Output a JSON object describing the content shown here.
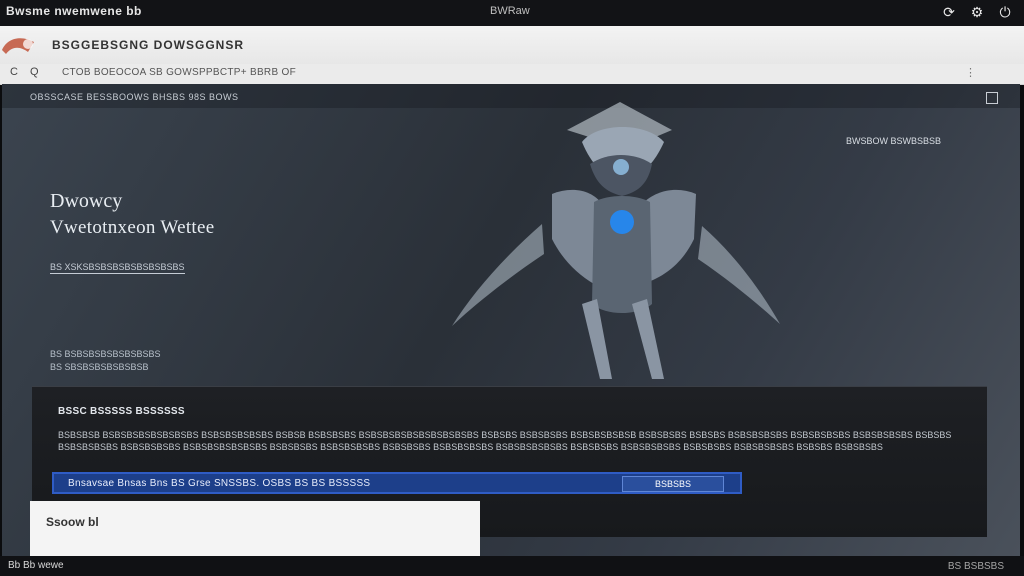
{
  "top_bar": {
    "left_text": "Bwsme nwemwene bb",
    "center_text": "BWRaw"
  },
  "title_bar": {
    "title": "BSGGEBSGNG DOWSGGNSR"
  },
  "address_bar": {
    "back": "C",
    "forward": "Q",
    "text": "CTOB BOEOCOA  SB GOWSPPBCTP+ BBRB OF"
  },
  "viewport": {
    "header": "OBSSCASE BESSBOOWS BHSBS 98S BOWS",
    "hero_title": "Dwowcy",
    "hero_subtitle": "Vwetotnxeon Wettee",
    "hero_underline": "BS XSKSBSBSBSBSBSBSBSBS",
    "side_note_1": "BS BSBSBSBSBSBSBSBS",
    "side_note_2": "BS SBSBSBSBSBSBSB",
    "right_note": "BWSBOW BSWBSBSB"
  },
  "panel": {
    "title": "BSSC BSSSSS BSSSSSS",
    "body": "BSBSBSB BSBSBSBSBSBSBSBS BSBSBSBSBSBS BSBSB BSBSBSBS BSBSBSBSBSBSBSBSBSBS BSBSBS BSBSBSBS BSBSBSBSBSB BSBSBSBS BSBSBS BSBSBSBSBS BSBSBSBSBS BSBSBSBSBS BSBSBS BSBSBSBSBS BSBSBSBSBS BSBSBSBSBSBSBS BSBSBSBS BSBSBSBSBS BSBSBSBS BSBSBSBSBS BSBSBSBSBSBS BSBSBSBS BSBSBSBSBS BSBSBSBS BSBSBSBSBS BSBSBS BSBSBSBS",
    "cta_text": "Bnsavsae Bnsas Bns BS Grse SNSSBS. OSBS BS BS BSSSSS",
    "cta_button": "BSBSBS"
  },
  "bottom_left": {
    "text": "Ssoow bl"
  },
  "status_bar": {
    "left": "Bb Bb wewe",
    "right": "BS BSBSBS"
  },
  "colors": {
    "cta": "#1d3f8a",
    "accent": "#2f5cc5",
    "viewport_bg": "#2a3038"
  },
  "icons": {
    "refresh": "refresh-icon",
    "settings": "gear-icon",
    "power": "power-icon",
    "app_logo": "app-logo-icon"
  }
}
